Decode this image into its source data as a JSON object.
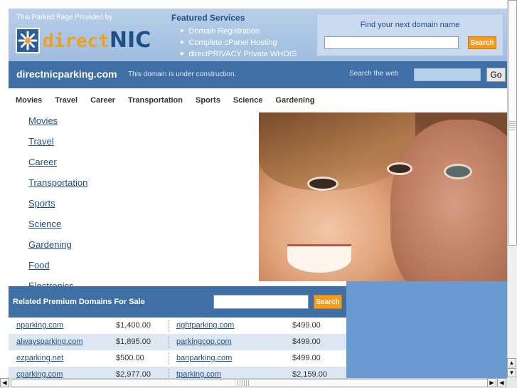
{
  "banner": {
    "provided_text": "This Parked Page Provided by",
    "logo_text_a": "direct",
    "logo_text_b": "NIC",
    "featured_title": "Featured Services",
    "featured_items": [
      "Domain Registration",
      "Complete cPanel Hosting",
      "directPRIVACY Private WHOIS"
    ],
    "find_label": "Find your next domain name",
    "find_placeholder": "",
    "find_button": "Search"
  },
  "domain_bar": {
    "domain": "directnicparking.com",
    "subtitle": "This domain is under construction.",
    "search_label": "Search the web",
    "go_button": "Go"
  },
  "nav": [
    "Movies",
    "Travel",
    "Career",
    "Transportation",
    "Sports",
    "Science",
    "Gardening"
  ],
  "left_links": [
    "Movies",
    "Travel",
    "Career",
    "Transportation",
    "Sports",
    "Science",
    "Gardening",
    "Food",
    "Electronics"
  ],
  "related": {
    "title": "Related Premium Domains For Sale",
    "search_button": "Search",
    "rows": [
      {
        "d1": "nparking.com",
        "p1": "$1,400.00",
        "d2": "rightparking.com",
        "p2": "$499.00"
      },
      {
        "d1": "alwaysparking.com",
        "p1": "$1,895.00",
        "d2": "parkingcop.com",
        "p2": "$499.00"
      },
      {
        "d1": "ezparking.net",
        "p1": "$500.00",
        "d2": "banparking.com",
        "p2": "$499.00"
      },
      {
        "d1": "cparking.com",
        "p1": "$2,977.00",
        "d2": "tparking.com",
        "p2": "$2,159.00"
      }
    ]
  },
  "colors": {
    "banner": "#a9c5e5",
    "domain_bar": "#3f6fa4",
    "accent_orange": "#f39a1f",
    "link": "#1f4f8a"
  },
  "icons": {
    "logo_mark": "snowflake-logo-icon",
    "featured_bullet": "triangle-right-icon",
    "scroll_up": "arrow-up-icon",
    "scroll_down": "arrow-down-icon",
    "scroll_left": "arrow-left-icon",
    "scroll_right": "arrow-right-icon"
  }
}
